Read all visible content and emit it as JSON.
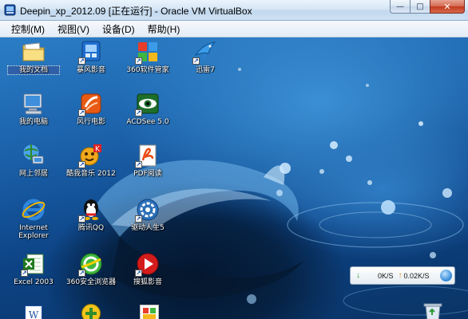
{
  "window": {
    "title": "Deepin_xp_2012.09 [正在运行] - Oracle VM VirtualBox",
    "minimize_glyph": "—",
    "maximize_glyph": "□",
    "close_glyph": "✕"
  },
  "menu": {
    "items": [
      "控制(M)",
      "视图(V)",
      "设备(D)",
      "帮助(H)"
    ]
  },
  "desktop": {
    "icons": [
      {
        "label": "我的文档",
        "icon": "folder-documents-icon"
      },
      {
        "label": "暴风影音",
        "icon": "storm-player-icon"
      },
      {
        "label": "360软件管家",
        "icon": "360-software-manager-icon"
      },
      {
        "label": "迅雷7",
        "icon": "xunlei-icon"
      },
      {
        "label": "我的电脑",
        "icon": "computer-icon"
      },
      {
        "label": "风行电影",
        "icon": "funshion-icon"
      },
      {
        "label": "ACDSee 5.0",
        "icon": "acdsee-icon"
      },
      {
        "label": "网上邻居",
        "icon": "network-icon"
      },
      {
        "label": "酷我音乐 2012",
        "icon": "kuwo-music-icon"
      },
      {
        "label": "PDF阅读",
        "icon": "pdf-reader-icon"
      },
      {
        "label": "Internet Explorer",
        "icon": "ie-icon"
      },
      {
        "label": "腾讯QQ",
        "icon": "qq-icon"
      },
      {
        "label": "驱动人生5",
        "icon": "driver-life-icon"
      },
      {
        "label": "Excel 2003",
        "icon": "excel-icon"
      },
      {
        "label": "360安全浏览器",
        "icon": "360-browser-icon"
      },
      {
        "label": "搜狐影音",
        "icon": "sohu-video-icon"
      }
    ]
  },
  "netspeed": {
    "down": "0K/S",
    "up": "0.02K/S",
    "down_arrow": "↓",
    "up_arrow": "↑"
  },
  "colors": {
    "selection": "#2f5fa8",
    "close_button": "#c23a1e",
    "desktop_blue": "#1a5fa8"
  }
}
